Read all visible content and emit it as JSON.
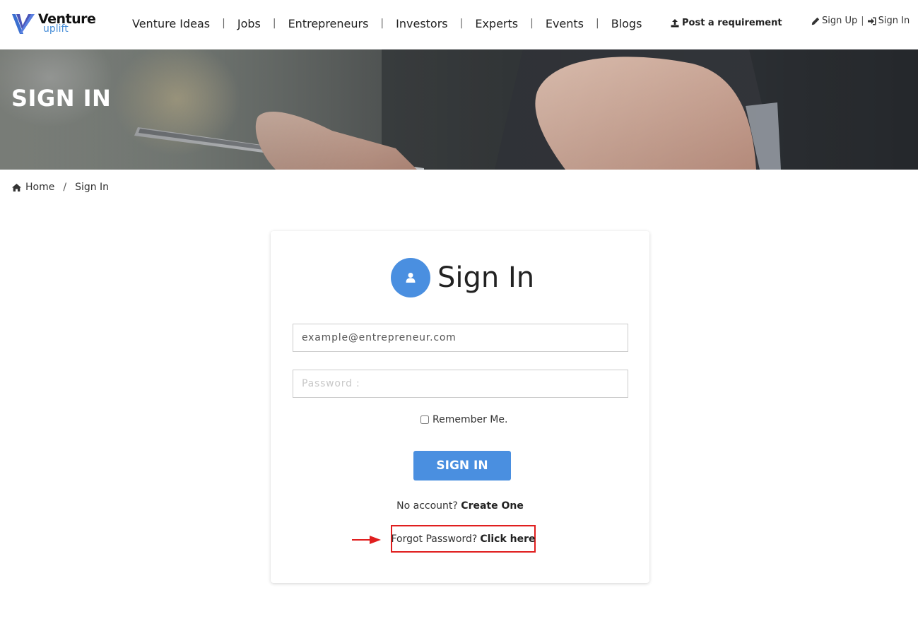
{
  "header": {
    "logo": {
      "word1": "Venture",
      "word2": "uplift"
    },
    "nav": [
      {
        "label": "Venture Ideas"
      },
      {
        "label": "Jobs"
      },
      {
        "label": "Entrepreneurs"
      },
      {
        "label": "Investors"
      },
      {
        "label": "Experts"
      },
      {
        "label": "Events"
      },
      {
        "label": "Blogs"
      }
    ],
    "nav_separator": "|",
    "post_requirement": "Post a requirement",
    "sign_up": "Sign Up",
    "auth_separator": "|",
    "sign_in": "Sign In"
  },
  "banner": {
    "title": "SIGN IN"
  },
  "breadcrumb": {
    "home": "Home",
    "separator": "/",
    "current": "Sign In"
  },
  "form": {
    "title": "Sign In",
    "email_value": "example@entrepreneur.com",
    "password_placeholder": "Password :",
    "remember_label": "Remember Me.",
    "submit_label": "SIGN IN",
    "no_account_text": "No account?",
    "create_one": "Create One",
    "forgot_text": "Forgot Password?",
    "click_here": "Click here"
  },
  "colors": {
    "accent": "#4a8fe0",
    "annotation": "#e01e1e"
  }
}
